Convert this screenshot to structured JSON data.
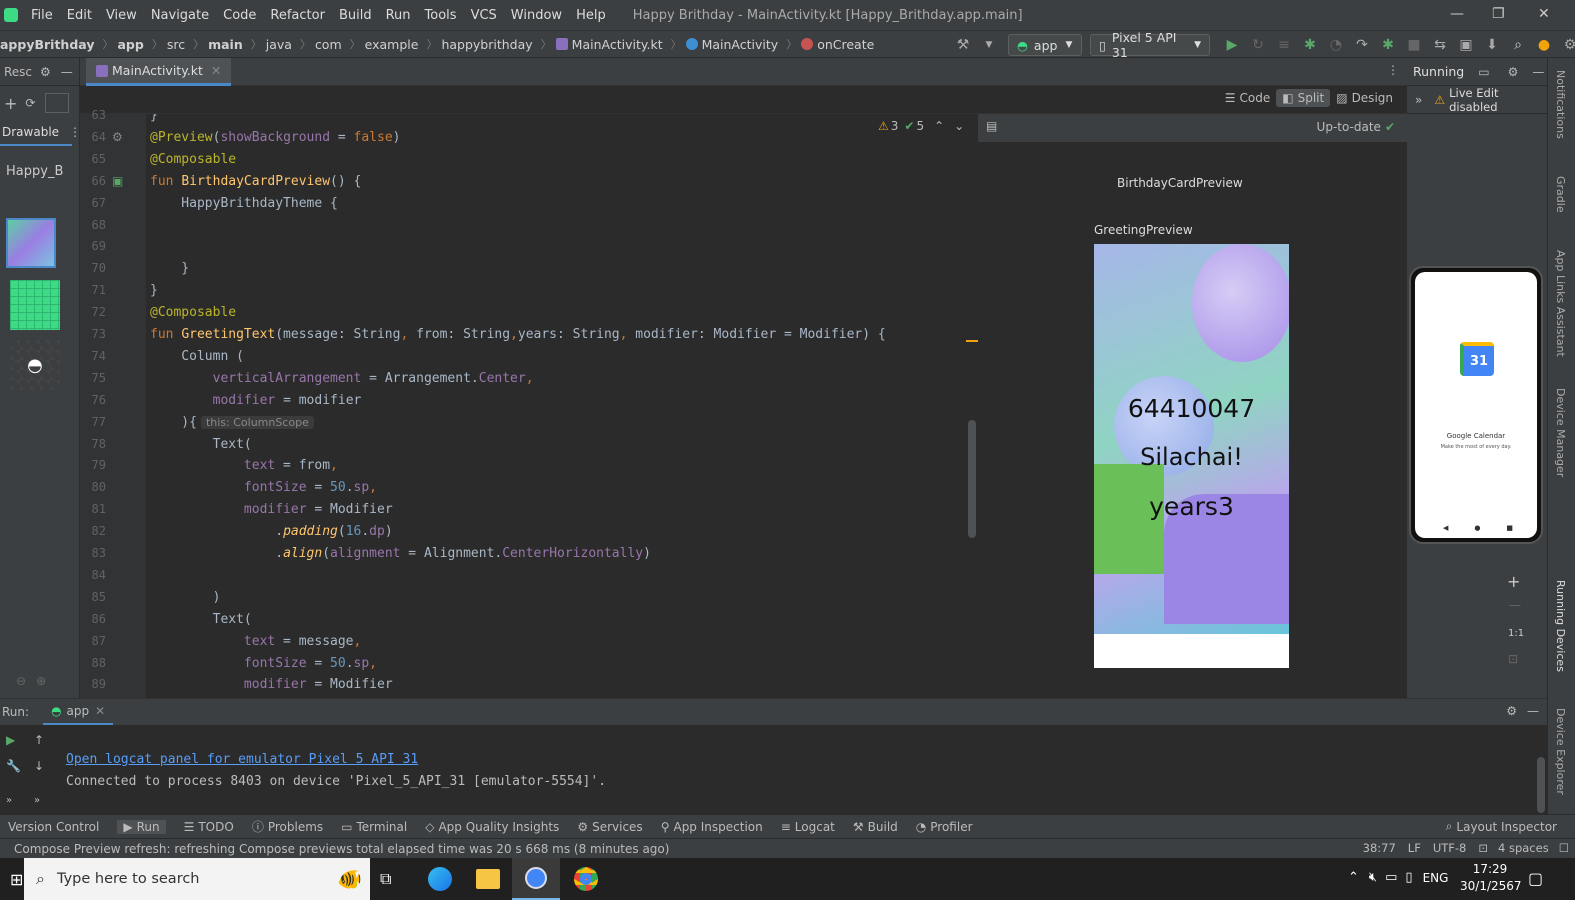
{
  "menubar": {
    "items": [
      "File",
      "Edit",
      "View",
      "Navigate",
      "Code",
      "Refactor",
      "Build",
      "Run",
      "Tools",
      "VCS",
      "Window",
      "Help"
    ],
    "title": "Happy Brithday - MainActivity.kt [Happy_Brithday.app.main]"
  },
  "breadcrumb": [
    "appyBrithday",
    "app",
    "src",
    "main",
    "java",
    "com",
    "example",
    "happybrithday",
    "MainActivity.kt",
    "MainActivity",
    "onCreate"
  ],
  "toolbar": {
    "config": "app",
    "device": "Pixel 5 API 31"
  },
  "leftpanel": {
    "title": "Resc",
    "tab": "Drawable",
    "filter": "Happy_B"
  },
  "editor": {
    "tab": "MainActivity.kt",
    "modes": [
      "Code",
      "Split",
      "Design"
    ],
    "warnings": "3",
    "checks": "5",
    "lines": [
      {
        "n": "63",
        "t": [
          [
            "}",
            "tp"
          ]
        ]
      },
      {
        "n": "64",
        "t": [
          [
            "@Preview",
            "ann"
          ],
          [
            "(",
            "tp"
          ],
          [
            "showBackground",
            "prm"
          ],
          [
            " = ",
            "tp"
          ],
          [
            "false",
            "kw"
          ],
          [
            ")",
            "tp"
          ]
        ]
      },
      {
        "n": "65",
        "t": [
          [
            "@Composable",
            "ann"
          ]
        ]
      },
      {
        "n": "66",
        "t": [
          [
            "fun ",
            "kw"
          ],
          [
            "BirthdayCardPreview",
            "fn"
          ],
          [
            "() {",
            "tp"
          ]
        ]
      },
      {
        "n": "67",
        "t": [
          [
            "    HappyBrithdayTheme {",
            "call"
          ]
        ]
      },
      {
        "n": "68",
        "t": []
      },
      {
        "n": "69",
        "t": []
      },
      {
        "n": "70",
        "t": [
          [
            "    }",
            "tp"
          ]
        ]
      },
      {
        "n": "71",
        "t": [
          [
            "}",
            "tp"
          ]
        ]
      },
      {
        "n": "72",
        "t": [
          [
            "@Composable",
            "ann"
          ]
        ]
      },
      {
        "n": "73",
        "t": [
          [
            "fun ",
            "kw"
          ],
          [
            "GreetingText",
            "fn"
          ],
          [
            "(message: String",
            "tp"
          ],
          [
            ", ",
            "kw"
          ],
          [
            "from: String",
            "tp"
          ],
          [
            ",",
            "kw"
          ],
          [
            "years: String",
            "tp"
          ],
          [
            ", ",
            "kw"
          ],
          [
            "modifier: Modifier = Modifier) {",
            "tp"
          ]
        ]
      },
      {
        "n": "74",
        "t": [
          [
            "    Column (",
            "call"
          ]
        ]
      },
      {
        "n": "75",
        "t": [
          [
            "        ",
            "tp"
          ],
          [
            "verticalArrangement",
            "prm"
          ],
          [
            " = Arrangement.",
            "tp"
          ],
          [
            "Center",
            "prm"
          ],
          [
            ",",
            "kw"
          ]
        ]
      },
      {
        "n": "76",
        "t": [
          [
            "        ",
            "tp"
          ],
          [
            "modifier",
            "prm"
          ],
          [
            " = modifier",
            "tp"
          ]
        ]
      },
      {
        "n": "77",
        "t": [
          [
            "    ){",
            "tp"
          ]
        ],
        "hint": "this: ColumnScope"
      },
      {
        "n": "78",
        "t": [
          [
            "        Text(",
            "call"
          ]
        ]
      },
      {
        "n": "79",
        "t": [
          [
            "            ",
            "tp"
          ],
          [
            "text",
            "prm"
          ],
          [
            " = from",
            "tp"
          ],
          [
            ",",
            "kw"
          ]
        ]
      },
      {
        "n": "80",
        "t": [
          [
            "            ",
            "tp"
          ],
          [
            "fontSize",
            "prm"
          ],
          [
            " = ",
            "tp"
          ],
          [
            "50",
            "num"
          ],
          [
            ".",
            "tp"
          ],
          [
            "sp",
            "prm"
          ],
          [
            ",",
            "kw"
          ]
        ]
      },
      {
        "n": "81",
        "t": [
          [
            "            ",
            "tp"
          ],
          [
            "modifier",
            "prm"
          ],
          [
            " = Modifier",
            "tp"
          ]
        ]
      },
      {
        "n": "82",
        "t": [
          [
            "                .",
            "tp"
          ],
          [
            "padding",
            "ital"
          ],
          [
            "(",
            "tp"
          ],
          [
            "16",
            "num"
          ],
          [
            ".",
            "tp"
          ],
          [
            "dp",
            "prm"
          ],
          [
            ")",
            "tp"
          ]
        ]
      },
      {
        "n": "83",
        "t": [
          [
            "                .",
            "tp"
          ],
          [
            "align",
            "ital"
          ],
          [
            "(",
            "tp"
          ],
          [
            "alignment",
            "prm"
          ],
          [
            " = Alignment.",
            "tp"
          ],
          [
            "CenterHorizontally",
            "prm"
          ],
          [
            ")",
            "tp"
          ]
        ]
      },
      {
        "n": "84",
        "t": []
      },
      {
        "n": "85",
        "t": [
          [
            "        )",
            "tp"
          ]
        ]
      },
      {
        "n": "86",
        "t": [
          [
            "        Text(",
            "call"
          ]
        ]
      },
      {
        "n": "87",
        "t": [
          [
            "            ",
            "tp"
          ],
          [
            "text",
            "prm"
          ],
          [
            " = message",
            "tp"
          ],
          [
            ",",
            "kw"
          ]
        ]
      },
      {
        "n": "88",
        "t": [
          [
            "            ",
            "tp"
          ],
          [
            "fontSize",
            "prm"
          ],
          [
            " = ",
            "tp"
          ],
          [
            "50",
            "num"
          ],
          [
            ".",
            "tp"
          ],
          [
            "sp",
            "prm"
          ],
          [
            ",",
            "kw"
          ]
        ]
      },
      {
        "n": "89",
        "t": [
          [
            "            ",
            "tp"
          ],
          [
            "modifier",
            "prm"
          ],
          [
            " = Modifier",
            "tp"
          ]
        ]
      }
    ]
  },
  "preview": {
    "status": "Up-to-date",
    "label1": "BirthdayCardPreview",
    "label2": "GreetingPreview",
    "text1": "64410047",
    "text2": "Silachai!",
    "text3": "years3"
  },
  "rightpanel": {
    "title": "Running",
    "live_edit": "Live Edit disabled",
    "zoom": "1:1",
    "cal_num": "31",
    "cal_title": "Google Calendar",
    "cal_sub": "Make the most of every day."
  },
  "rightstrip": [
    "Notifications",
    "Gradle",
    "App Links Assistant",
    "Device Manager",
    "Running Devices",
    "Device Explorer"
  ],
  "run": {
    "label": "Run:",
    "tab": "app",
    "link": "Open logcat panel for emulator Pixel 5 API 31",
    "line2": "Connected to process 8403 on device 'Pixel_5_API_31 [emulator-5554]'."
  },
  "toolwindows": [
    "Version Control",
    "Run",
    "TODO",
    "Problems",
    "Terminal",
    "App Quality Insights",
    "Services",
    "App Inspection",
    "Logcat",
    "Build",
    "Profiler"
  ],
  "layout_inspector": "Layout Inspector",
  "status": {
    "msg": "Compose Preview refresh: refreshing Compose previews total elapsed time was 20 s 668 ms (8 minutes ago)",
    "pos": "38:77",
    "le": "LF",
    "enc": "UTF-8",
    "indent": "4 spaces"
  },
  "taskbar": {
    "search": "Type here to search",
    "lang": "ENG",
    "time": "17:29",
    "date": "30/1/2567"
  }
}
